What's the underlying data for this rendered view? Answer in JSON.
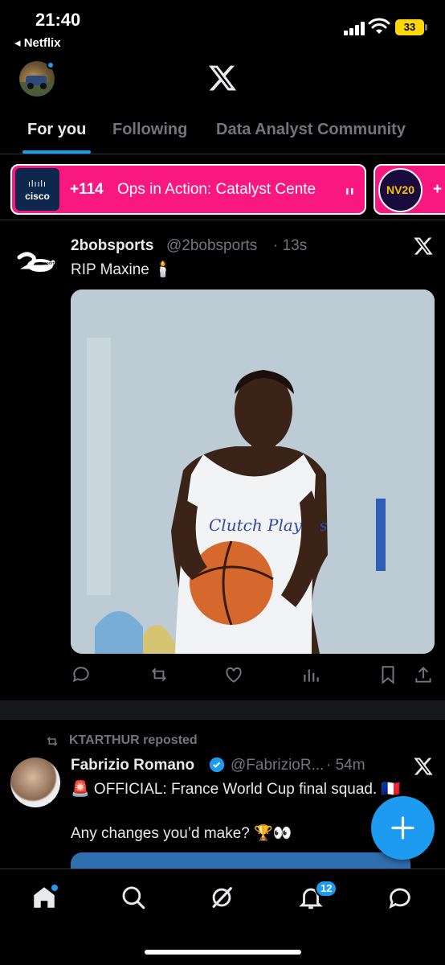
{
  "status": {
    "time": "21:40",
    "back_app": "◂ Netflix",
    "battery": "33"
  },
  "tabs": [
    {
      "label": "For you"
    },
    {
      "label": "Following"
    },
    {
      "label": "Data Analyst Community"
    }
  ],
  "spaces": [
    {
      "logo_text": "cisco",
      "count": "+114",
      "title": "Ops in Action: Catalyst Cente",
      "live_icon": "audio-bars-icon"
    },
    {
      "logo_text": "NV20",
      "count": "+"
    }
  ],
  "tweets": [
    {
      "name": "2bobsports",
      "handle": "@2bobsports",
      "time": "· 13s",
      "text": "RIP Maxine 🕯️",
      "media_alt_text": "Clutch Players"
    },
    {
      "repost_line": "KTARTHUR reposted",
      "name": "Fabrizio Romano",
      "handle": "@FabrizioR...",
      "time": "· 54m",
      "text": "🚨 OFFICIAL: France World Cup final squad. 🇫🇷",
      "text2": "Any changes you’d make? 🏆👀"
    }
  ],
  "nav": {
    "notifications_badge": "12"
  },
  "colors": {
    "accent": "#1d9bf0",
    "space_pink": "#f91880",
    "background": "#000000"
  }
}
